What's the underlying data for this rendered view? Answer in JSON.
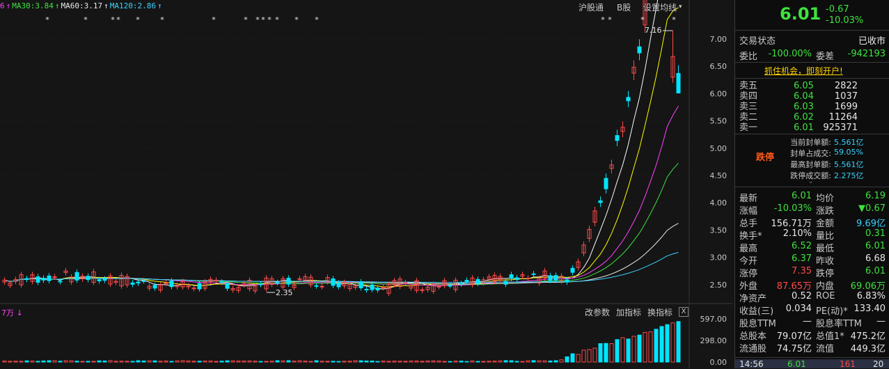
{
  "ma_bar": [
    {
      "text": "6",
      "color": "#ff44ff"
    },
    {
      "text": "↑",
      "color": "#ff44ff"
    },
    {
      "text": "MA30:3.84",
      "color": "#3ee23e"
    },
    {
      "text": "↑",
      "color": "#3ee23e"
    },
    {
      "text": "MA60:3.17",
      "color": "#e8e8e8"
    },
    {
      "text": "↑",
      "color": "#e8e8e8"
    },
    {
      "text": "MA120:2.86",
      "color": "#3ad2ff"
    },
    {
      "text": "↑",
      "color": "#3ad2ff"
    }
  ],
  "toolbar": {
    "hgt": "沪股通",
    "b": "B股",
    "settings": "设置均线"
  },
  "price_axis": [
    "7.00",
    "6.50",
    "6.00",
    "5.50",
    "5.00",
    "4.50",
    "4.00",
    "3.50",
    "3.00",
    "2.50"
  ],
  "annotations": {
    "high": "7.16",
    "low": "2.35"
  },
  "vol_label": "7万",
  "vol_axis": [
    "597.00",
    "298.00",
    "0.00"
  ],
  "subtoolbar": {
    "params": "改参数",
    "add": "加指标",
    "switch": "换指标",
    "close": "X"
  },
  "colors": {
    "up": "#ff4a4a",
    "down": "#00e5ff",
    "ma5": "#ffffff",
    "ma10": "#ffff00",
    "ma20": "#ff44ff",
    "ma30": "#3ee23e",
    "ma60": "#e8e8e8",
    "ma120": "#3ad2ff"
  },
  "quote": {
    "price": "6.01",
    "change": "-0.67",
    "pct": "-10.03%"
  },
  "status": {
    "label": "交易状态",
    "value": "已收市"
  },
  "ratio": {
    "l1": "委比",
    "v1": "-100.00%",
    "l2": "委差",
    "v2": "-942193"
  },
  "promo": "抓住机会，即刻开户!",
  "orderbook": [
    {
      "label": "卖五",
      "price": "6.05",
      "vol": "2822"
    },
    {
      "label": "卖四",
      "price": "6.04",
      "vol": "1037"
    },
    {
      "label": "卖三",
      "price": "6.03",
      "vol": "1699"
    },
    {
      "label": "卖二",
      "price": "6.02",
      "vol": "11264"
    },
    {
      "label": "卖一",
      "price": "6.01",
      "vol": "925371"
    }
  ],
  "limit": {
    "title": "跌停",
    "rows": [
      {
        "k": "当前封单额:",
        "v": "5.561亿"
      },
      {
        "k": "封单占成交:",
        "v": "59.05%"
      },
      {
        "k": "最高封单额:",
        "v": "5.561亿"
      },
      {
        "k": "跌停成交额:",
        "v": "2.275亿"
      }
    ]
  },
  "stats": [
    {
      "l": "最新",
      "lv": "6.01",
      "lc": "g",
      "r": "均价",
      "rv": "6.19",
      "rc": "g"
    },
    {
      "l": "涨幅",
      "lv": "-10.03%",
      "lc": "g",
      "r": "涨跌",
      "rv": "▼0.67",
      "rc": "g"
    },
    {
      "l": "总手",
      "lv": "156.71万",
      "lc": "w",
      "r": "金额",
      "rv": "9.69亿",
      "rc": "cy"
    },
    {
      "l": "换手*",
      "lv": "2.10%",
      "lc": "w",
      "r": "量比",
      "rv": "0.31",
      "rc": "g"
    },
    {
      "l": "最高",
      "lv": "6.52",
      "lc": "g",
      "r": "最低",
      "rv": "6.01",
      "rc": "g"
    },
    {
      "l": "今开",
      "lv": "6.37",
      "lc": "g",
      "r": "昨收",
      "rv": "6.68",
      "rc": "w"
    },
    {
      "l": "涨停",
      "lv": "7.35",
      "lc": "red",
      "r": "跌停",
      "rv": "6.01",
      "rc": "g"
    },
    {
      "l": "外盘",
      "lv": "87.65万",
      "lc": "red",
      "r": "内盘",
      "rv": "69.06万",
      "rc": "g"
    },
    {
      "l": "净资产",
      "lv": "0.52",
      "lc": "w",
      "r": "ROE",
      "rv": "6.83%",
      "rc": "w"
    },
    {
      "l": "收益(三)",
      "lv": "0.034",
      "lc": "w",
      "r": "PE(动)*",
      "rv": "133.40",
      "rc": "w"
    },
    {
      "l": "股息TTM",
      "lv": "—",
      "lc": "w",
      "r": "股息率TTM",
      "rv": "—",
      "rc": "w"
    },
    {
      "l": "总股本",
      "lv": "79.07亿",
      "lc": "w",
      "r": "总值1*",
      "rv": "475.2亿",
      "rc": "w"
    },
    {
      "l": "流通股",
      "lv": "74.75亿",
      "lc": "w",
      "r": "流值",
      "rv": "449.3亿",
      "rc": "w"
    }
  ],
  "tick": {
    "time": "14:56",
    "price": "6.01",
    "vol": "161",
    "num": "20"
  }
}
